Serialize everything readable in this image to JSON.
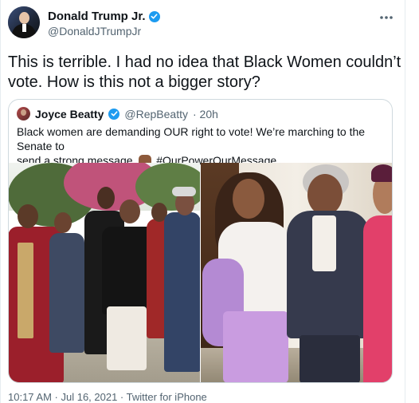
{
  "tweet": {
    "author": {
      "display_name": "Donald Trump Jr.",
      "handle": "@DonaldJTrumpJr",
      "verified": true
    },
    "text": "This is terrible. I had no idea that Black Women couldn’t vote. How is this not a bigger story?",
    "more_icon": "more-horizontal-icon",
    "timestamp": "10:17 AM · Jul 16, 2021 · Twitter for iPhone"
  },
  "quoted_tweet": {
    "author": {
      "display_name": "Joyce Beatty",
      "handle": "@RepBeatty",
      "time_ago": "· 20h",
      "verified": true
    },
    "text_line1": "Black women are demanding OUR right to vote! We’re marching to the Senate to",
    "text_line2": "send a strong message.",
    "hashtag": "#OurPowerOurMessage",
    "photos": [
      {
        "description": "photo-march"
      },
      {
        "description": "photo-portrait"
      }
    ]
  },
  "colors": {
    "verified_blue": "#1d9bf0",
    "secondary_text": "#536471",
    "border": "#cfd9de"
  }
}
